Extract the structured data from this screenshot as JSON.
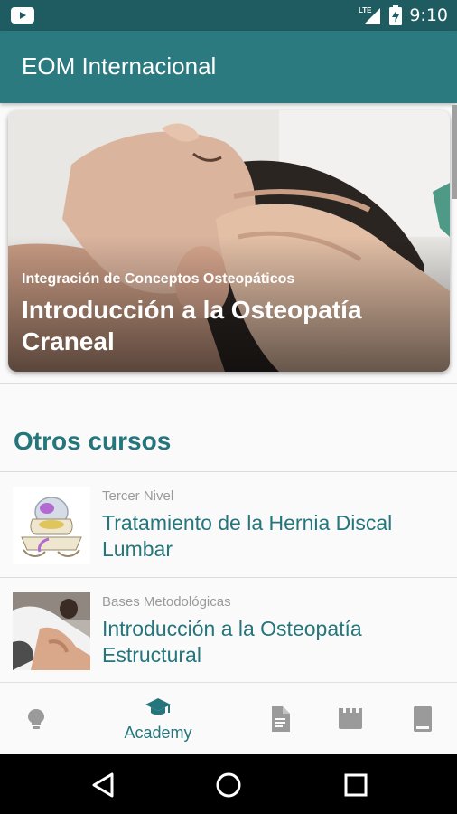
{
  "status_bar": {
    "time": "9:10",
    "network": "LTE",
    "icons": [
      "youtube-icon",
      "signal-icon",
      "battery-charging-icon"
    ]
  },
  "app_bar": {
    "title": "EOM Internacional"
  },
  "featured": {
    "category": "Integración de Conceptos Osteopáticos",
    "title": "Introducción a la Osteopatía Craneal"
  },
  "section": {
    "title": "Otros cursos"
  },
  "courses": [
    {
      "category": "Tercer Nivel",
      "title": "Tratamiento de la Hernia Discal Lumbar",
      "thumb_icon": "spine-disc-illustration"
    },
    {
      "category": "Bases Metodológicas",
      "title": "Introducción a la Osteopatía Estructural",
      "thumb_icon": "manual-therapy-photo"
    }
  ],
  "bottom_nav": {
    "items": [
      {
        "icon": "lightbulb-icon",
        "label": ""
      },
      {
        "icon": "graduation-cap-icon",
        "label": "Academy",
        "active": true
      },
      {
        "icon": "document-icon",
        "label": ""
      },
      {
        "icon": "video-icon",
        "label": ""
      },
      {
        "icon": "book-icon",
        "label": ""
      }
    ]
  },
  "colors": {
    "status_bar": "#1f5c62",
    "app_bar": "#2a7a80",
    "accent": "#25767c",
    "nav_icon_inactive": "#8a8a8a"
  }
}
